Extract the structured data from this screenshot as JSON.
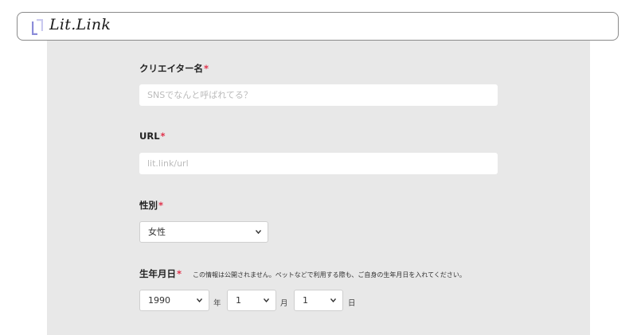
{
  "header": {
    "logo_text": "Lit.Link",
    "logo_icon": "bracket-logo-icon",
    "accent_color": "#8b8cd9"
  },
  "form": {
    "creator_name": {
      "label": "クリエイター名",
      "required_mark": "*",
      "placeholder": "SNSでなんと呼ばれてる？"
    },
    "url": {
      "label": "URL",
      "required_mark": "*",
      "placeholder": "lit.link/url"
    },
    "gender": {
      "label": "性別",
      "required_mark": "*",
      "selected": "女性"
    },
    "birthday": {
      "label": "生年月日",
      "required_mark": "*",
      "note": "この情報は公開されません。ペットなどで利用する際も、ご自身の生年月日を入れてください。",
      "year": {
        "selected": "1990",
        "unit": "年"
      },
      "month": {
        "selected": "1",
        "unit": "月"
      },
      "day": {
        "selected": "1",
        "unit": "日"
      }
    },
    "required_color": "#e0314b"
  }
}
